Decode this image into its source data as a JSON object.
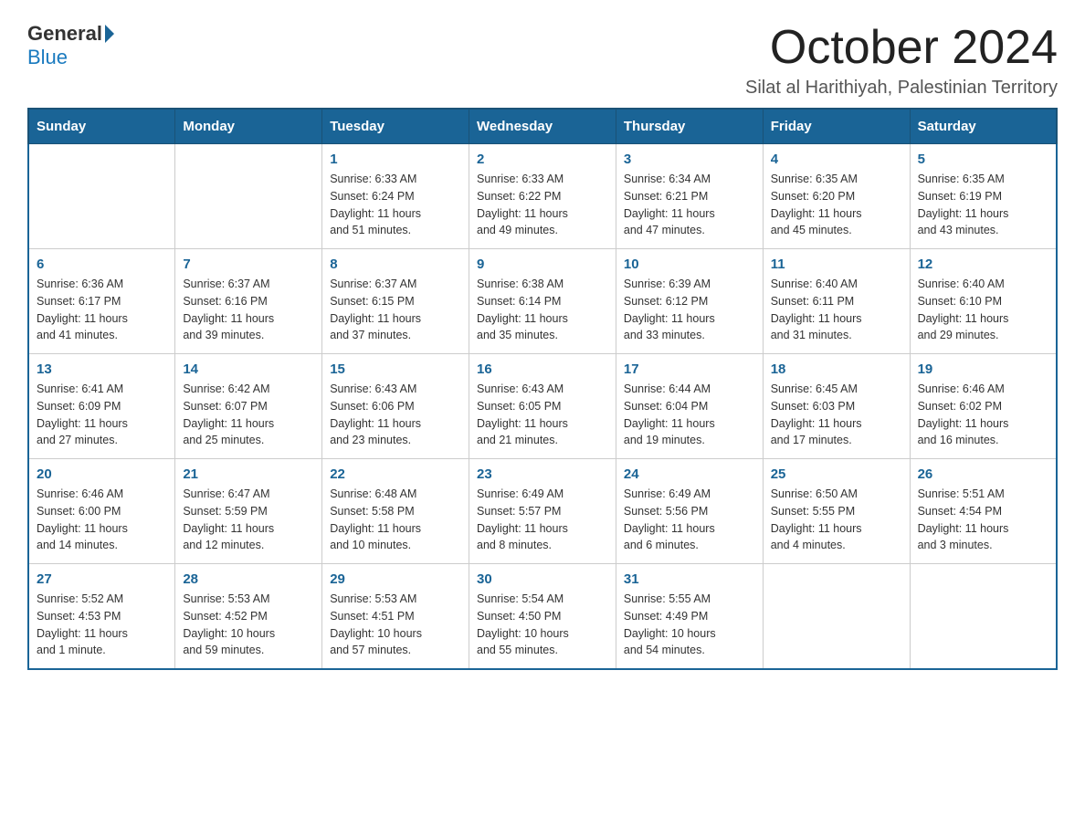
{
  "logo": {
    "general": "General",
    "blue": "Blue"
  },
  "header": {
    "title": "October 2024",
    "subtitle": "Silat al Harithiyah, Palestinian Territory"
  },
  "days_of_week": [
    "Sunday",
    "Monday",
    "Tuesday",
    "Wednesday",
    "Thursday",
    "Friday",
    "Saturday"
  ],
  "weeks": [
    [
      {
        "day": "",
        "info": ""
      },
      {
        "day": "",
        "info": ""
      },
      {
        "day": "1",
        "info": "Sunrise: 6:33 AM\nSunset: 6:24 PM\nDaylight: 11 hours\nand 51 minutes."
      },
      {
        "day": "2",
        "info": "Sunrise: 6:33 AM\nSunset: 6:22 PM\nDaylight: 11 hours\nand 49 minutes."
      },
      {
        "day": "3",
        "info": "Sunrise: 6:34 AM\nSunset: 6:21 PM\nDaylight: 11 hours\nand 47 minutes."
      },
      {
        "day": "4",
        "info": "Sunrise: 6:35 AM\nSunset: 6:20 PM\nDaylight: 11 hours\nand 45 minutes."
      },
      {
        "day": "5",
        "info": "Sunrise: 6:35 AM\nSunset: 6:19 PM\nDaylight: 11 hours\nand 43 minutes."
      }
    ],
    [
      {
        "day": "6",
        "info": "Sunrise: 6:36 AM\nSunset: 6:17 PM\nDaylight: 11 hours\nand 41 minutes."
      },
      {
        "day": "7",
        "info": "Sunrise: 6:37 AM\nSunset: 6:16 PM\nDaylight: 11 hours\nand 39 minutes."
      },
      {
        "day": "8",
        "info": "Sunrise: 6:37 AM\nSunset: 6:15 PM\nDaylight: 11 hours\nand 37 minutes."
      },
      {
        "day": "9",
        "info": "Sunrise: 6:38 AM\nSunset: 6:14 PM\nDaylight: 11 hours\nand 35 minutes."
      },
      {
        "day": "10",
        "info": "Sunrise: 6:39 AM\nSunset: 6:12 PM\nDaylight: 11 hours\nand 33 minutes."
      },
      {
        "day": "11",
        "info": "Sunrise: 6:40 AM\nSunset: 6:11 PM\nDaylight: 11 hours\nand 31 minutes."
      },
      {
        "day": "12",
        "info": "Sunrise: 6:40 AM\nSunset: 6:10 PM\nDaylight: 11 hours\nand 29 minutes."
      }
    ],
    [
      {
        "day": "13",
        "info": "Sunrise: 6:41 AM\nSunset: 6:09 PM\nDaylight: 11 hours\nand 27 minutes."
      },
      {
        "day": "14",
        "info": "Sunrise: 6:42 AM\nSunset: 6:07 PM\nDaylight: 11 hours\nand 25 minutes."
      },
      {
        "day": "15",
        "info": "Sunrise: 6:43 AM\nSunset: 6:06 PM\nDaylight: 11 hours\nand 23 minutes."
      },
      {
        "day": "16",
        "info": "Sunrise: 6:43 AM\nSunset: 6:05 PM\nDaylight: 11 hours\nand 21 minutes."
      },
      {
        "day": "17",
        "info": "Sunrise: 6:44 AM\nSunset: 6:04 PM\nDaylight: 11 hours\nand 19 minutes."
      },
      {
        "day": "18",
        "info": "Sunrise: 6:45 AM\nSunset: 6:03 PM\nDaylight: 11 hours\nand 17 minutes."
      },
      {
        "day": "19",
        "info": "Sunrise: 6:46 AM\nSunset: 6:02 PM\nDaylight: 11 hours\nand 16 minutes."
      }
    ],
    [
      {
        "day": "20",
        "info": "Sunrise: 6:46 AM\nSunset: 6:00 PM\nDaylight: 11 hours\nand 14 minutes."
      },
      {
        "day": "21",
        "info": "Sunrise: 6:47 AM\nSunset: 5:59 PM\nDaylight: 11 hours\nand 12 minutes."
      },
      {
        "day": "22",
        "info": "Sunrise: 6:48 AM\nSunset: 5:58 PM\nDaylight: 11 hours\nand 10 minutes."
      },
      {
        "day": "23",
        "info": "Sunrise: 6:49 AM\nSunset: 5:57 PM\nDaylight: 11 hours\nand 8 minutes."
      },
      {
        "day": "24",
        "info": "Sunrise: 6:49 AM\nSunset: 5:56 PM\nDaylight: 11 hours\nand 6 minutes."
      },
      {
        "day": "25",
        "info": "Sunrise: 6:50 AM\nSunset: 5:55 PM\nDaylight: 11 hours\nand 4 minutes."
      },
      {
        "day": "26",
        "info": "Sunrise: 5:51 AM\nSunset: 4:54 PM\nDaylight: 11 hours\nand 3 minutes."
      }
    ],
    [
      {
        "day": "27",
        "info": "Sunrise: 5:52 AM\nSunset: 4:53 PM\nDaylight: 11 hours\nand 1 minute."
      },
      {
        "day": "28",
        "info": "Sunrise: 5:53 AM\nSunset: 4:52 PM\nDaylight: 10 hours\nand 59 minutes."
      },
      {
        "day": "29",
        "info": "Sunrise: 5:53 AM\nSunset: 4:51 PM\nDaylight: 10 hours\nand 57 minutes."
      },
      {
        "day": "30",
        "info": "Sunrise: 5:54 AM\nSunset: 4:50 PM\nDaylight: 10 hours\nand 55 minutes."
      },
      {
        "day": "31",
        "info": "Sunrise: 5:55 AM\nSunset: 4:49 PM\nDaylight: 10 hours\nand 54 minutes."
      },
      {
        "day": "",
        "info": ""
      },
      {
        "day": "",
        "info": ""
      }
    ]
  ]
}
